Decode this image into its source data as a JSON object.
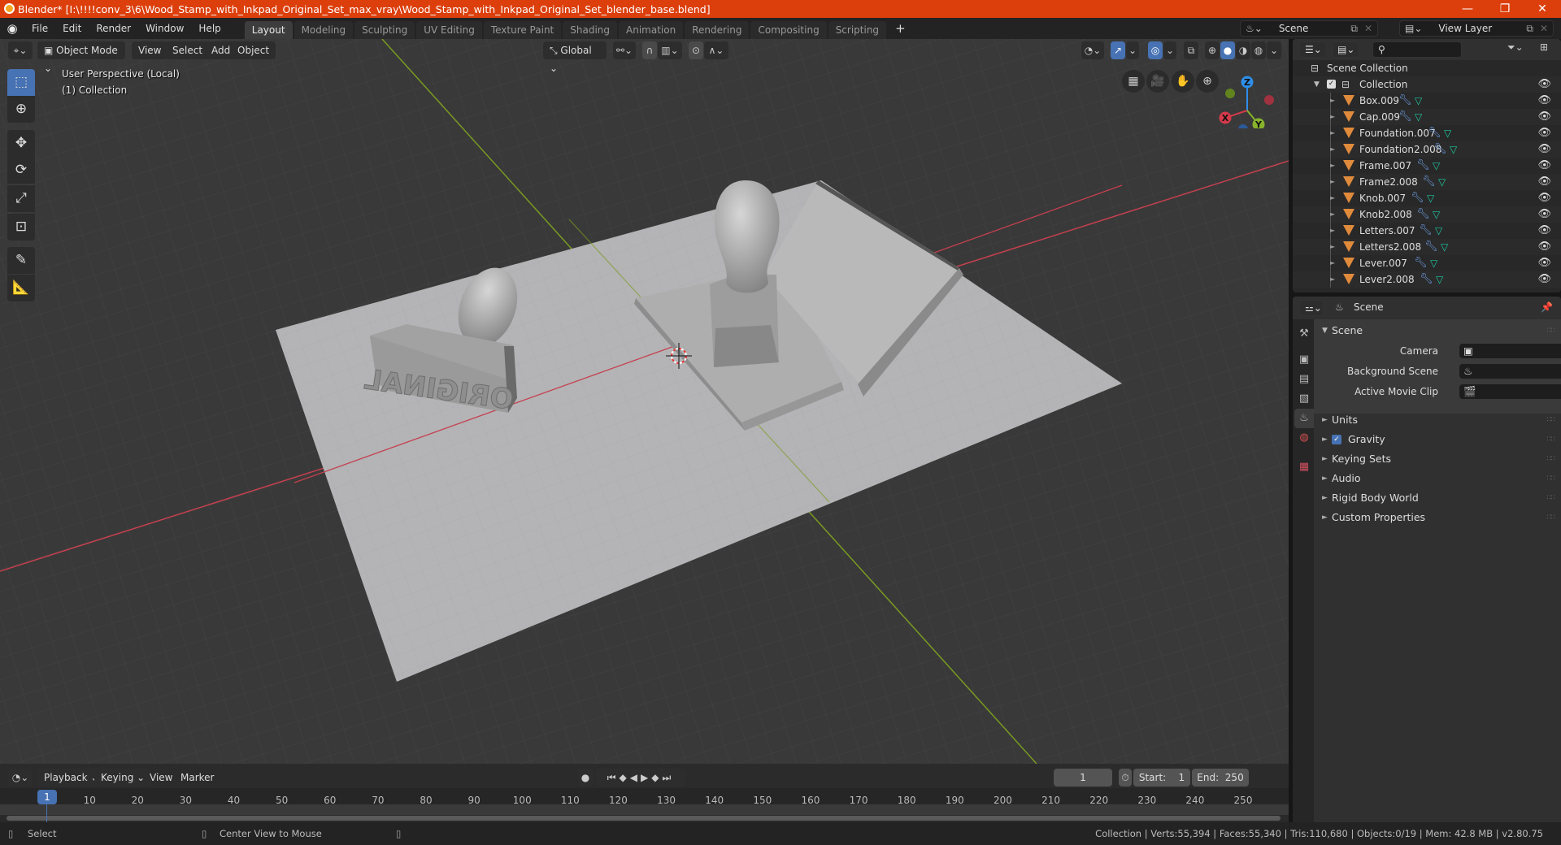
{
  "window": {
    "title": "Blender* [I:\\!!!!conv_3\\6\\Wood_Stamp_with_Inkpad_Original_Set_max_vray\\Wood_Stamp_with_Inkpad_Original_Set_blender_base.blend]",
    "minimize": "—",
    "maximize": "❐",
    "close": "✕"
  },
  "menu": [
    "File",
    "Edit",
    "Render",
    "Window",
    "Help"
  ],
  "workspaces": [
    {
      "label": "Layout",
      "active": true
    },
    {
      "label": "Modeling"
    },
    {
      "label": "Sculpting"
    },
    {
      "label": "UV Editing"
    },
    {
      "label": "Texture Paint"
    },
    {
      "label": "Shading"
    },
    {
      "label": "Animation"
    },
    {
      "label": "Rendering"
    },
    {
      "label": "Compositing"
    },
    {
      "label": "Scripting"
    }
  ],
  "add_workspace": "+",
  "scene_selector": {
    "value": "Scene"
  },
  "view_layer_selector": {
    "value": "View Layer"
  },
  "viewport": {
    "mode": "Object Mode",
    "menus": [
      "View",
      "Select",
      "Add",
      "Object"
    ],
    "orientation": "Global",
    "overlay_text_line1": "User Perspective (Local)",
    "overlay_text_line2": "(1) Collection",
    "gizmo_axes": {
      "x": "X",
      "y": "Y",
      "z": "Z"
    },
    "colors": {
      "x_axis": "#d53a4b",
      "y_axis": "#87b32b",
      "z_axis": "#2f8ee8",
      "accent": "#4772b3"
    },
    "stamp_text": "ORIGINAL"
  },
  "outliner": {
    "root": "Scene Collection",
    "collection": "Collection",
    "objects": [
      "Box.009",
      "Cap.009",
      "Foundation.007",
      "Foundation2.008",
      "Frame.007",
      "Frame2.008",
      "Knob.007",
      "Knob2.008",
      "Letters.007",
      "Letters2.008",
      "Lever.007",
      "Lever2.008"
    ]
  },
  "properties": {
    "header": "Scene",
    "panel_title": "Scene",
    "fields": [
      {
        "label": "Camera",
        "value": ""
      },
      {
        "label": "Background Scene",
        "value": ""
      },
      {
        "label": "Active Movie Clip",
        "value": ""
      }
    ],
    "sections": [
      {
        "label": "Units"
      },
      {
        "label": "Gravity",
        "checkbox": true,
        "checked": true
      },
      {
        "label": "Keying Sets"
      },
      {
        "label": "Audio"
      },
      {
        "label": "Rigid Body World"
      },
      {
        "label": "Custom Properties"
      }
    ]
  },
  "timeline": {
    "menus": [
      "Playback",
      "Keying",
      "View",
      "Marker"
    ],
    "current_frame": "1",
    "start_label": "Start:",
    "start": "1",
    "end_label": "End:",
    "end": "250",
    "ticks": [
      "10",
      "20",
      "30",
      "40",
      "50",
      "60",
      "70",
      "80",
      "90",
      "100",
      "110",
      "120",
      "130",
      "140",
      "150",
      "160",
      "170",
      "180",
      "190",
      "200",
      "210",
      "220",
      "230",
      "240",
      "250"
    ],
    "playhead": "1"
  },
  "statusbar": {
    "left_action": "Select",
    "middle_action": "Center View to Mouse",
    "stats": "Collection | Verts:55,394 | Faces:55,340 | Tris:110,680 | Objects:0/19 | Mem: 42.8 MB | v2.80.75"
  }
}
